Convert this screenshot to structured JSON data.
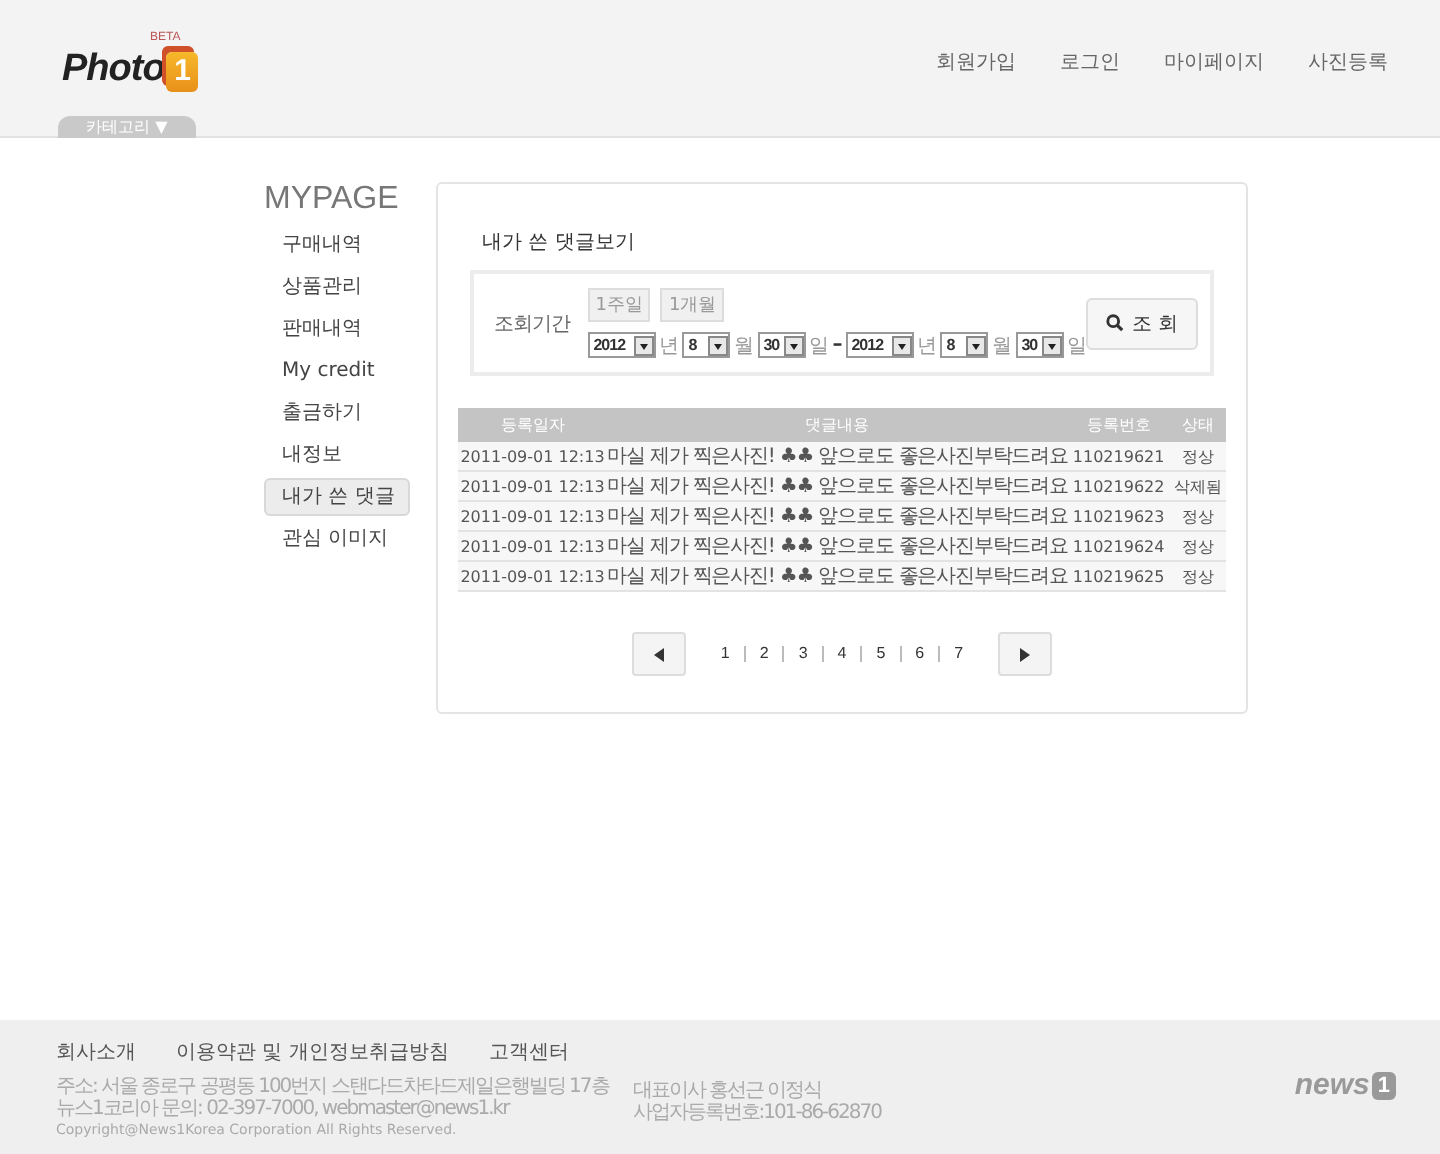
{
  "header": {
    "logo": {
      "word": "Photo",
      "badge": "1",
      "tag": "BETA"
    },
    "nav": [
      "회원가입",
      "로그인",
      "마이페이지",
      "사진등록"
    ],
    "category_tab": "카테고리 ▼"
  },
  "sidebar": {
    "title": "MYPAGE",
    "items": [
      {
        "label": "구매내역",
        "selected": false
      },
      {
        "label": "상품관리",
        "selected": false
      },
      {
        "label": "판매내역",
        "selected": false
      },
      {
        "label": "My credit",
        "selected": false
      },
      {
        "label": "출금하기",
        "selected": false
      },
      {
        "label": "내정보",
        "selected": false
      },
      {
        "label": "내가 쓴 댓글",
        "selected": true
      },
      {
        "label": "관심 이미지",
        "selected": false
      }
    ]
  },
  "content": {
    "title": "내가 쓴 댓글보기",
    "search": {
      "label": "조회기간",
      "quick_buttons": [
        "1주일",
        "1개월"
      ],
      "date_from": {
        "year": "2012",
        "year_unit": "년",
        "month": "8",
        "month_unit": "월",
        "day": "30",
        "day_unit": "일"
      },
      "separator": "–",
      "date_to": {
        "year": "2012",
        "year_unit": "년",
        "month": "8",
        "month_unit": "월",
        "day": "30",
        "day_unit": "일"
      },
      "button": "조 회"
    },
    "table": {
      "columns": [
        "등록일자",
        "댓글내용",
        "등록번호",
        "상태"
      ],
      "rows": [
        [
          "2011-09-01 12:13",
          "마실 제가 찍은사진! ♣♣ 앞으로도 좋은사진부탁드려요",
          "110219621",
          "정상"
        ],
        [
          "2011-09-01 12:13",
          "마실 제가 찍은사진! ♣♣ 앞으로도 좋은사진부탁드려요",
          "110219622",
          "삭제됨"
        ],
        [
          "2011-09-01 12:13",
          "마실 제가 찍은사진! ♣♣ 앞으로도 좋은사진부탁드려요",
          "110219623",
          "정상"
        ],
        [
          "2011-09-01 12:13",
          "마실 제가 찍은사진! ♣♣ 앞으로도 좋은사진부탁드려요",
          "110219624",
          "정상"
        ],
        [
          "2011-09-01 12:13",
          "마실 제가 찍은사진! ♣♣ 앞으로도 좋은사진부탁드려요",
          "110219625",
          "정상"
        ]
      ]
    },
    "pagination": {
      "pages": [
        "1",
        "2",
        "3",
        "4",
        "5",
        "6",
        "7"
      ]
    }
  },
  "footer": {
    "links": [
      "회사소개",
      "이용약관 및 개인정보취급방침",
      "고객센터"
    ],
    "info_left": [
      "주소: 서울 종로구 공평동 100번지 스탠다드차타드제일은행빌딩 17층",
      "뉴스1코리아 문의: 02-397-7000, webmaster@news1.kr",
      "Copyright@News1Korea Corporation All Rights Reserved."
    ],
    "info_right": [
      "대표이사 홍선근 이정식",
      "사업자등록번호:101-86-62870"
    ],
    "logo": {
      "word": "news",
      "badge": "1"
    }
  }
}
